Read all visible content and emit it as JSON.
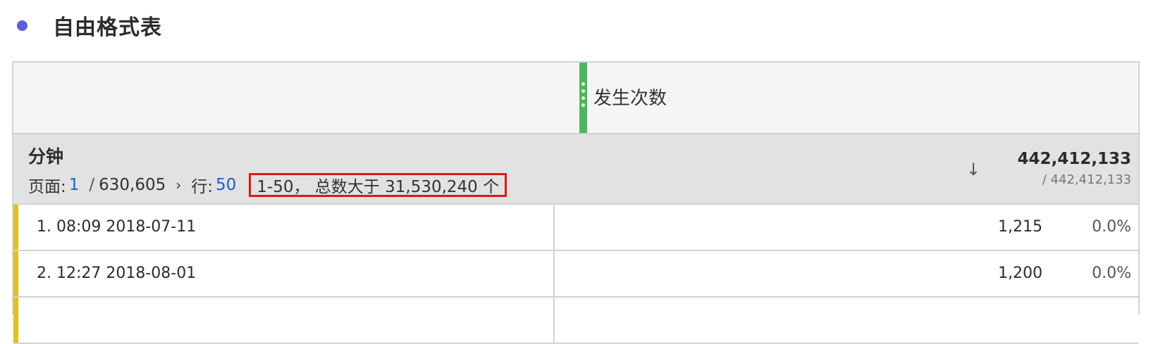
{
  "panel": {
    "title": "自由格式表"
  },
  "table": {
    "metric_header": "发生次数",
    "dimension_name": "分钟",
    "pager": {
      "page_label": "页面:",
      "current_page": "1",
      "separator": "/",
      "total_pages": "630,605",
      "chevron": "›",
      "rows_label": "行:",
      "rows_per_page": "50",
      "range_text": "1-50， 总数大于 31,530,240 个"
    },
    "sort_icon": "arrow-down-icon",
    "sort_glyph": "↓",
    "total": "442,412,133",
    "total_sub": "/ 442,412,133",
    "rows": [
      {
        "label": "1.  08:09 2018-07-11",
        "value": "1,215",
        "percent": "0.0%"
      },
      {
        "label": "2.  12:27 2018-08-01",
        "value": "1,200",
        "percent": "0.0%"
      },
      {
        "label": "",
        "value": "",
        "percent": ""
      }
    ]
  },
  "colors": {
    "title_dot": "#5c5ce0",
    "metric_bar": "#4cb85c",
    "row_accent": "#e2c21a",
    "highlight_box": "#e01818",
    "link": "#1a5fd1"
  }
}
